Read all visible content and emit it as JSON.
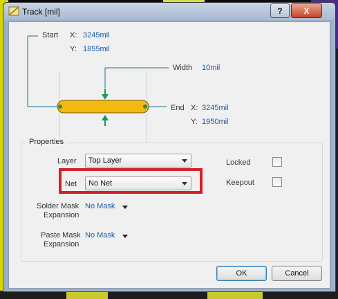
{
  "window": {
    "title": "Track [mil]",
    "help_label": "?",
    "close_label": "X"
  },
  "diagram": {
    "start_label": "Start",
    "start_x_label": "X:",
    "start_x": "3245mil",
    "start_y_label": "Y:",
    "start_y": "1855mil",
    "width_label": "Width",
    "width": "10mil",
    "end_label": "End",
    "end_x_label": "X:",
    "end_x": "3245mil",
    "end_y_label": "Y:",
    "end_y": "1950mil",
    "track_color": "#f2b90f",
    "line_color": "#1a6f8f",
    "arrow_color": "#1a9a5a"
  },
  "properties": {
    "group_title": "Properties",
    "layer_label": "Layer",
    "layer_value": "Top Layer",
    "net_label": "Net",
    "net_value": "No Net",
    "solder_label_1": "Solder Mask",
    "solder_label_2": "Expansion",
    "solder_value": "No Mask",
    "paste_label_1": "Paste Mask",
    "paste_label_2": "Expansion",
    "paste_value": "No Mask",
    "locked_label": "Locked",
    "locked_checked": false,
    "keepout_label": "Keepout",
    "keepout_checked": false,
    "highlight_color": "#d42027"
  },
  "buttons": {
    "ok": "OK",
    "cancel": "Cancel"
  }
}
